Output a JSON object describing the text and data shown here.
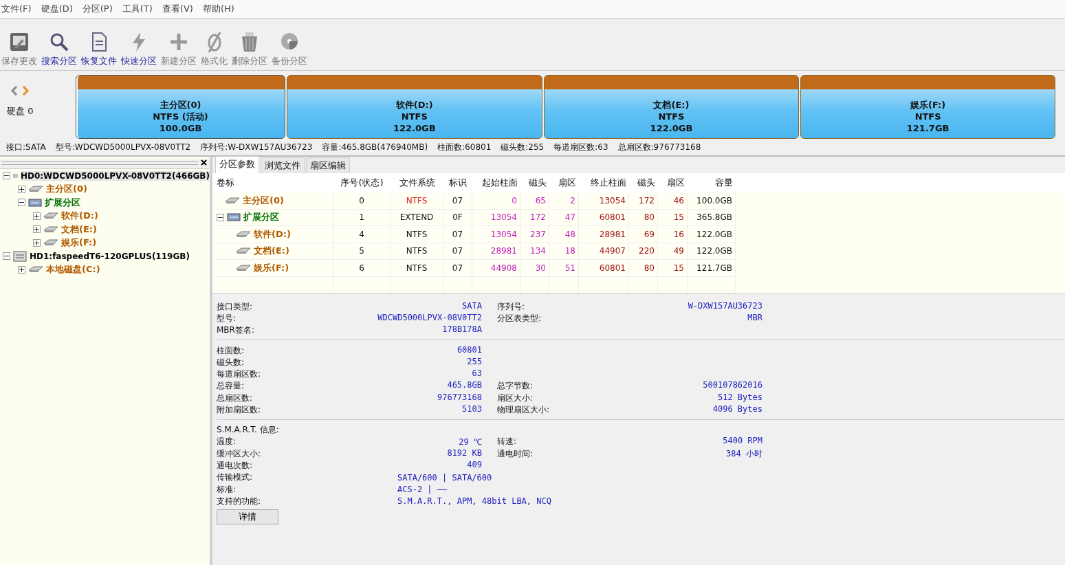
{
  "menu": [
    "文件(F)",
    "硬盘(D)",
    "分区(P)",
    "工具(T)",
    "查看(V)",
    "帮助(H)"
  ],
  "toolbar": [
    {
      "kind": "save",
      "label": "保存更改",
      "disabled": true
    },
    {
      "kind": "search",
      "label": "搜索分区",
      "disabled": false
    },
    {
      "kind": "recover",
      "label": "恢复文件",
      "disabled": false
    },
    {
      "kind": "quick",
      "label": "快速分区",
      "disabled": false
    },
    {
      "kind": "new",
      "label": "新建分区",
      "disabled": true
    },
    {
      "kind": "format",
      "label": "格式化",
      "disabled": true
    },
    {
      "kind": "delete",
      "label": "删除分区",
      "disabled": true
    },
    {
      "kind": "backup",
      "label": "备份分区",
      "disabled": true
    }
  ],
  "disk_nav": {
    "label": "硬盘 0"
  },
  "partitions": [
    {
      "name": "主分区(0)",
      "fs": "NTFS (活动)",
      "size": "100.0GB",
      "selected": true
    },
    {
      "name": "软件(D:)",
      "fs": "NTFS",
      "size": "122.0GB",
      "selected": false
    },
    {
      "name": "文档(E:)",
      "fs": "NTFS",
      "size": "122.0GB",
      "selected": false
    },
    {
      "name": "娱乐(F:)",
      "fs": "NTFS",
      "size": "121.7GB",
      "selected": false
    }
  ],
  "disk_info": [
    "接口:SATA",
    "型号:WDCWD5000LPVX-08V0TT2",
    "序列号:W-DXW157AU36723",
    "容量:465.8GB(476940MB)",
    "柱面数:60801",
    "磁头数:255",
    "每道扇区数:63",
    "总扇区数:976773168"
  ],
  "tree": [
    {
      "kind": "disk",
      "label": "HD0:WDCWD5000LPVX-08V0TT2(466GB)",
      "expanded": true,
      "selected": true,
      "children": [
        {
          "kind": "primary",
          "label": "主分区(0)",
          "expanded": false,
          "selected": false
        },
        {
          "kind": "extended",
          "label": "扩展分区",
          "expanded": true,
          "selected": false,
          "children": [
            {
              "kind": "logical",
              "label": "软件(D:)",
              "expanded": false,
              "selected": false
            },
            {
              "kind": "logical",
              "label": "文档(E:)",
              "expanded": false,
              "selected": false
            },
            {
              "kind": "logical",
              "label": "娱乐(F:)",
              "expanded": false,
              "selected": false
            }
          ]
        }
      ]
    },
    {
      "kind": "disk",
      "label": "HD1:faspeedT6-120GPLUS(119GB)",
      "expanded": true,
      "selected": false,
      "children": [
        {
          "kind": "primary",
          "label": "本地磁盘(C:)",
          "expanded": false,
          "selected": false
        }
      ]
    }
  ],
  "tabs": [
    {
      "label": "分区参数",
      "selected": true
    },
    {
      "label": "浏览文件",
      "selected": false
    },
    {
      "label": "扇区编辑",
      "selected": false
    }
  ],
  "table": {
    "columns": [
      "卷标",
      "序号(状态)",
      "文件系统",
      "标识",
      "起始柱面",
      "磁头",
      "扇区",
      "终止柱面",
      "磁头",
      "扇区",
      "容量"
    ],
    "rows": [
      {
        "kind": "primary",
        "active": true,
        "cells": [
          "主分区(0)",
          "0",
          "NTFS",
          "07",
          "0",
          "65",
          "2",
          "13054",
          "172",
          "46",
          "100.0GB"
        ]
      },
      {
        "kind": "extended",
        "active": false,
        "expanded": true,
        "cells": [
          "扩展分区",
          "1",
          "EXTEND",
          "0F",
          "13054",
          "172",
          "47",
          "60801",
          "80",
          "15",
          "365.8GB"
        ],
        "children": [
          {
            "kind": "logical",
            "active": false,
            "cells": [
              "软件(D:)",
              "4",
              "NTFS",
              "07",
              "13054",
              "237",
              "48",
              "28981",
              "69",
              "16",
              "122.0GB"
            ]
          },
          {
            "kind": "logical",
            "active": false,
            "cells": [
              "文档(E:)",
              "5",
              "NTFS",
              "07",
              "28981",
              "134",
              "18",
              "44907",
              "220",
              "49",
              "122.0GB"
            ]
          },
          {
            "kind": "logical",
            "active": false,
            "cells": [
              "娱乐(F:)",
              "6",
              "NTFS",
              "07",
              "44908",
              "30",
              "51",
              "60801",
              "80",
              "15",
              "121.7GB"
            ]
          }
        ]
      }
    ]
  },
  "details": [
    {
      "rows": [
        {
          "kind": "pair",
          "left": {
            "label": "接口类型:",
            "value": "SATA"
          },
          "right": {
            "label": "序列号:",
            "value": "W-DXW157AU36723"
          }
        },
        {
          "kind": "pair",
          "left": {
            "label": "型号:",
            "value": "WDCWD5000LPVX-08V0TT2"
          },
          "right": {
            "label": "分区表类型:",
            "value": "MBR"
          }
        },
        {
          "kind": "pair",
          "left": {
            "label": "MBR签名:",
            "value": "178B178A"
          }
        }
      ]
    },
    {
      "rows": [
        {
          "kind": "pair",
          "left": {
            "label": "柱面数:",
            "value": "60801"
          }
        },
        {
          "kind": "pair",
          "left": {
            "label": "磁头数:",
            "value": "255"
          }
        },
        {
          "kind": "pair",
          "left": {
            "label": "每道扇区数:",
            "value": "63"
          }
        },
        {
          "kind": "pair",
          "left": {
            "label": "总容量:",
            "value": "465.8GB"
          },
          "right": {
            "label": "总字节数:",
            "value": "500107862016"
          }
        },
        {
          "kind": "pair",
          "left": {
            "label": "总扇区数:",
            "value": "976773168"
          },
          "right": {
            "label": "扇区大小:",
            "value": "512 Bytes"
          }
        },
        {
          "kind": "pair",
          "left": {
            "label": "附加扇区数:",
            "value": "5103"
          },
          "right": {
            "label": "物理扇区大小:",
            "value": "4096 Bytes"
          }
        }
      ]
    },
    {
      "title": "S.M.A.R.T. 信息:",
      "button": "详情",
      "rows": [
        {
          "kind": "pair",
          "left": {
            "label": "温度:",
            "value": "29 ℃"
          },
          "right": {
            "label": "转速:",
            "value": "5400 RPM"
          }
        },
        {
          "kind": "pair",
          "left": {
            "label": "缓冲区大小:",
            "value": "8192 KB"
          },
          "right": {
            "label": "通电时间:",
            "value": "384 小时"
          }
        },
        {
          "kind": "pair",
          "left": {
            "label": "通电次数:",
            "value": "409"
          }
        },
        {
          "kind": "wide",
          "left": {
            "label": "传输模式:",
            "value": "SATA/600 | SATA/600"
          }
        },
        {
          "kind": "wide",
          "left": {
            "label": "标准:",
            "value": "ACS-2 | ——"
          }
        },
        {
          "kind": "wide",
          "left": {
            "label": "支持的功能:",
            "value": "S.M.A.R.T., APM, 48bit LBA, NCQ"
          }
        }
      ]
    }
  ]
}
